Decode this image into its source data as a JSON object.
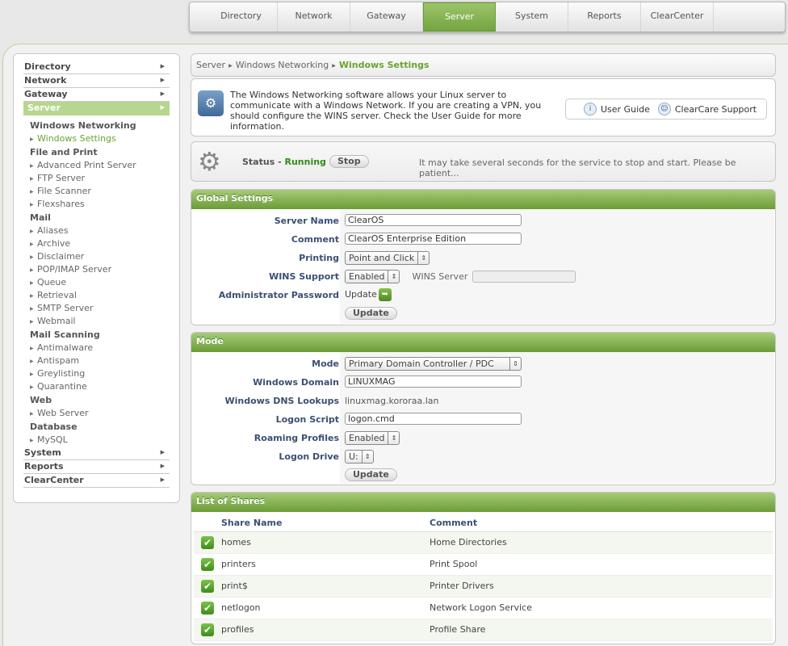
{
  "topnav": {
    "tabs": [
      {
        "label": "Directory"
      },
      {
        "label": "Network"
      },
      {
        "label": "Gateway"
      },
      {
        "label": "Server"
      },
      {
        "label": "System"
      },
      {
        "label": "Reports"
      },
      {
        "label": "ClearCenter"
      }
    ],
    "active": "Server"
  },
  "sidebar": {
    "top_before": [
      "Directory",
      "Network",
      "Gateway"
    ],
    "active_top": "Server",
    "groups": [
      {
        "title": "Windows Networking",
        "items": [
          "Windows Settings"
        ]
      },
      {
        "title": "File and Print",
        "items": [
          "Advanced Print Server",
          "FTP Server",
          "File Scanner",
          "Flexshares"
        ]
      },
      {
        "title": "Mail",
        "items": [
          "Aliases",
          "Archive",
          "Disclaimer",
          "POP/IMAP Server",
          "Queue",
          "Retrieval",
          "SMTP Server",
          "Webmail"
        ]
      },
      {
        "title": "Mail Scanning",
        "items": [
          "Antimalware",
          "Antispam",
          "Greylisting",
          "Quarantine"
        ]
      },
      {
        "title": "Web",
        "items": [
          "Web Server"
        ]
      },
      {
        "title": "Database",
        "items": [
          "MySQL"
        ]
      }
    ],
    "active_item": "Windows Settings",
    "top_after": [
      "System",
      "Reports",
      "ClearCenter"
    ]
  },
  "breadcrumb": {
    "c1": "Server",
    "c2": "Windows Networking",
    "current": "Windows Settings"
  },
  "intro": {
    "text": "The Windows Networking software allows your Linux server to communicate with a Windows Network.  If you are creating a VPN, you should configure the WINS server.  Check the User Guide for more information.",
    "user_guide": "User Guide",
    "support": "ClearCare Support"
  },
  "status": {
    "label": "Status",
    "dash": " - ",
    "value": "Running",
    "stop_label": "Stop",
    "message": "It may take several seconds for the service to stop and start.  Please be patient..."
  },
  "global": {
    "title": "Global Settings",
    "server_name_label": "Server Name",
    "server_name": "ClearOS",
    "comment_label": "Comment",
    "comment": "ClearOS Enterprise Edition",
    "printing_label": "Printing",
    "printing": "Point and Click",
    "wins_support_label": "WINS Support",
    "wins_support": "Enabled",
    "wins_server_label": "WINS Server",
    "wins_server": "",
    "admin_pw_label": "Administrator Password",
    "admin_pw_action": "Update",
    "update_label": "Update"
  },
  "mode": {
    "title": "Mode",
    "mode_label": "Mode",
    "mode": "Primary Domain Controller / PDC",
    "domain_label": "Windows Domain",
    "domain": "LINUXMAG",
    "dns_label": "Windows DNS Lookups",
    "dns": "linuxmag.kororaa.lan",
    "logon_script_label": "Logon Script",
    "logon_script": "logon.cmd",
    "roaming_label": "Roaming Profiles",
    "roaming": "Enabled",
    "drive_label": "Logon Drive",
    "drive": "U:",
    "update_label": "Update"
  },
  "shares": {
    "title": "List of Shares",
    "col_name": "Share Name",
    "col_comment": "Comment",
    "rows": [
      {
        "name": "homes",
        "comment": "Home Directories"
      },
      {
        "name": "printers",
        "comment": "Print Spool"
      },
      {
        "name": "print$",
        "comment": "Printer Drivers"
      },
      {
        "name": "netlogon",
        "comment": "Network Logon Service"
      },
      {
        "name": "profiles",
        "comment": "Profile Share"
      }
    ]
  },
  "colors": {
    "accent": "#74a540",
    "active_link": "#6aa330",
    "label": "#3b4f73",
    "running": "#2f8a1a"
  },
  "icons": [
    "gear-icon",
    "info-icon",
    "support-icon",
    "check-icon",
    "update-icon",
    "windows-settings-icon"
  ]
}
